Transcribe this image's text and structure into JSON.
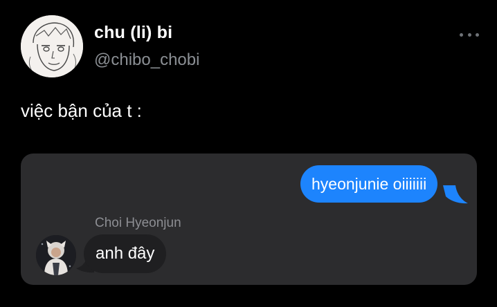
{
  "colors": {
    "background": "#000000",
    "handle_text": "#8b8f94",
    "card_background": "#2c2c2e",
    "outgoing_bubble": "#1d84fd",
    "incoming_bubble": "#1f1f21",
    "sender_name_text": "#8d8e93"
  },
  "tweet": {
    "author": {
      "display_name": "chu (li) bi",
      "handle": "@chibo_chobi",
      "avatar_icon": "sketch-face-avatar"
    },
    "more_icon": "more-horizontal-icon",
    "text": "việc bận của t :"
  },
  "chat": {
    "outgoing_message": "hyeonjunie oiiiiiii",
    "incoming": {
      "sender_name": "Choi Hyeonjun",
      "sender_avatar_icon": "profile-photo-avatar",
      "message": "anh đây"
    }
  }
}
